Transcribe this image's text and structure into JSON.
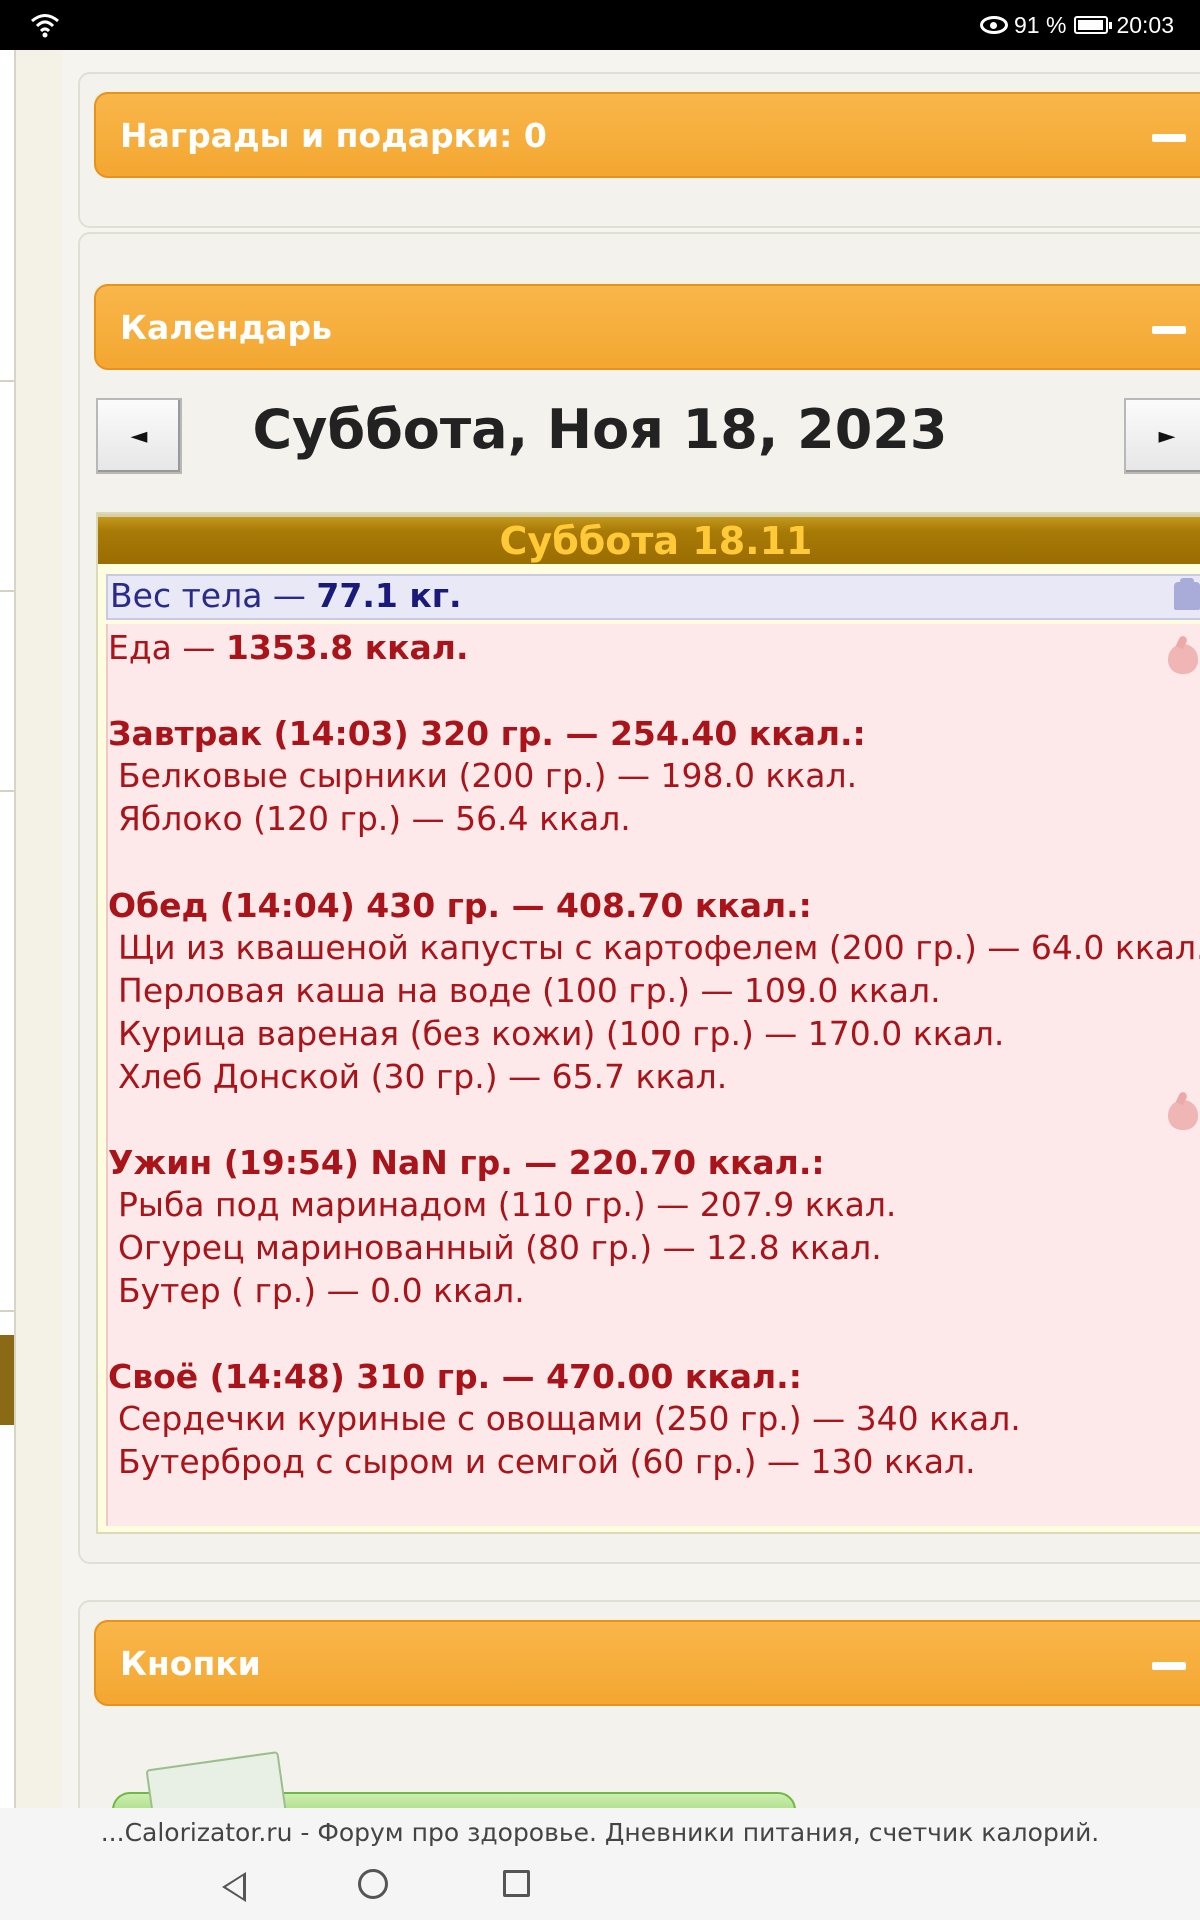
{
  "status_bar": {
    "battery": "91 %",
    "time": "20:03"
  },
  "panels": {
    "awards_title": "Награды и подарки: 0",
    "calendar_title": "Календарь",
    "buttons_title": "Кнопки"
  },
  "calendar": {
    "prev_label": "◄",
    "next_label": "►",
    "date_title": "Суббота, Ноя 18, 2023",
    "day_header": "Суббота 18.11"
  },
  "weight": {
    "label": "Вес тела — ",
    "value": "77.1 кг."
  },
  "food_total": {
    "label": "Еда — ",
    "value": "1353.8 ккал."
  },
  "meals": [
    {
      "title": "Завтрак (14:03) 320 гр. — 254.40 ккал.:",
      "items": [
        "Белковые сырники (200 гр.) — 198.0 ккал.",
        "Яблоко (120 гр.) — 56.4 ккал."
      ]
    },
    {
      "title": "Обед (14:04) 430 гр. — 408.70 ккал.:",
      "items": [
        "Щи из квашеной капусты с картофелем (200 гр.) — 64.0 ккал.",
        "Перловая каша на воде (100 гр.) — 109.0 ккал.",
        "Курица вареная (без кожи) (100 гр.) — 170.0 ккал.",
        "Хлеб Донской (30 гр.) — 65.7 ккал."
      ]
    },
    {
      "title": "Ужин (19:54) NaN гр. — 220.70 ккал.:",
      "items": [
        "Рыба под маринадом (110 гр.) — 207.9 ккал.",
        "Огурец маринованный (80 гр.) — 12.8 ккал.",
        "Бутер ( гр.) — 0.0 ккал."
      ]
    },
    {
      "title": "Своё (14:48) 310 гр. — 470.00 ккал.:",
      "items": [
        "Сердечки куриные с овощами (250 гр.) — 340 ккал.",
        "Бутерброд с сыром и семгой (60 гр.) — 130 ккал."
      ]
    }
  ],
  "footer": {
    "text": "...Calorizator.ru - Форум про здоровье. Дневники питания, счетчик калорий."
  },
  "colors": {
    "accent_orange": "#f4a731",
    "header_brown": "#9a6d02",
    "food_red": "#a8141a",
    "weight_blue": "#2a2a8a"
  }
}
